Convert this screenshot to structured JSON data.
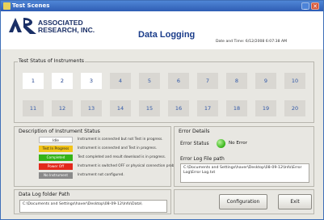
{
  "window": {
    "title": "Test Scenes"
  },
  "brand": {
    "line1": "ASSOCIATED",
    "line2": "RESEARCH, INC."
  },
  "page": {
    "title": "Data Logging",
    "datetime": "Date and Time: 6/12/2008 6:07:38 AM"
  },
  "instruments": {
    "section_label": "Test Status of Instruments",
    "items": [
      "1",
      "2",
      "3",
      "4",
      "5",
      "6",
      "7",
      "8",
      "9",
      "10",
      "11",
      "12",
      "13",
      "14",
      "15",
      "16",
      "17",
      "18",
      "19",
      "20"
    ]
  },
  "status_description": {
    "section_label": "Description of Instrument Status",
    "items": [
      {
        "badge": "Idle",
        "text": "Instrument is connected but not Test in progress.",
        "bg": "#ffffff",
        "fg": "#222222"
      },
      {
        "badge": "Test In Progress",
        "text": "Instrument is connected and Test in progress.",
        "bg": "#f2c318",
        "fg": "#222222"
      },
      {
        "badge": "Completed Normally",
        "text": "Test completed and result download is in progress.",
        "bg": "#35b318",
        "fg": "#ffffff"
      },
      {
        "badge": "Power Off",
        "text": "Instrument is switched OFF or physical connection problem.",
        "bg": "#e2281c",
        "fg": "#ffffff"
      },
      {
        "badge": "No Instrument",
        "text": "Instrument not configured.",
        "bg": "#8a8a8a",
        "fg": "#ffffff"
      }
    ]
  },
  "error": {
    "section_label": "Error Details",
    "status_label": "Error Status",
    "status_value": "No Error",
    "log_path_label": "Error Log File path",
    "log_path_value": "C:\\Documents and Settings\\haver\\Desktop\\08-09-12\\Info\\Error Log\\Error Log.txt"
  },
  "datalog": {
    "section_label": "Data Log folder Path",
    "value": "C:\\Documents and Settings\\haver\\Desktop\\08-09-12\\Info\\Data\\"
  },
  "buttons": {
    "configuration": "Configuration",
    "exit": "Exit"
  }
}
